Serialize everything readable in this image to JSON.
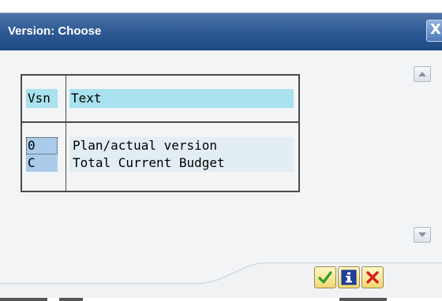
{
  "dialog": {
    "title": "Version: Choose",
    "close_label": "X"
  },
  "table": {
    "columns": [
      "Vsn",
      "Text"
    ],
    "rows": [
      {
        "vsn": "0",
        "text": "Plan/actual version"
      },
      {
        "vsn": "C",
        "text": "Total Current Budget"
      }
    ]
  },
  "toolbar": {
    "buttons": [
      {
        "name": "continue",
        "icon": "checkmark-icon",
        "color": "#2e9e2e"
      },
      {
        "name": "information",
        "icon": "info-icon",
        "color": "#1f3fa0"
      },
      {
        "name": "cancel",
        "icon": "cancel-x-icon",
        "color": "#d42020"
      }
    ]
  },
  "colors": {
    "titlebar": "#2e5a94",
    "header_cell": "#a9e2ee",
    "key_cell": "#aaccea",
    "text_cell": "#e3edf4",
    "background": "#f2f4f6"
  }
}
